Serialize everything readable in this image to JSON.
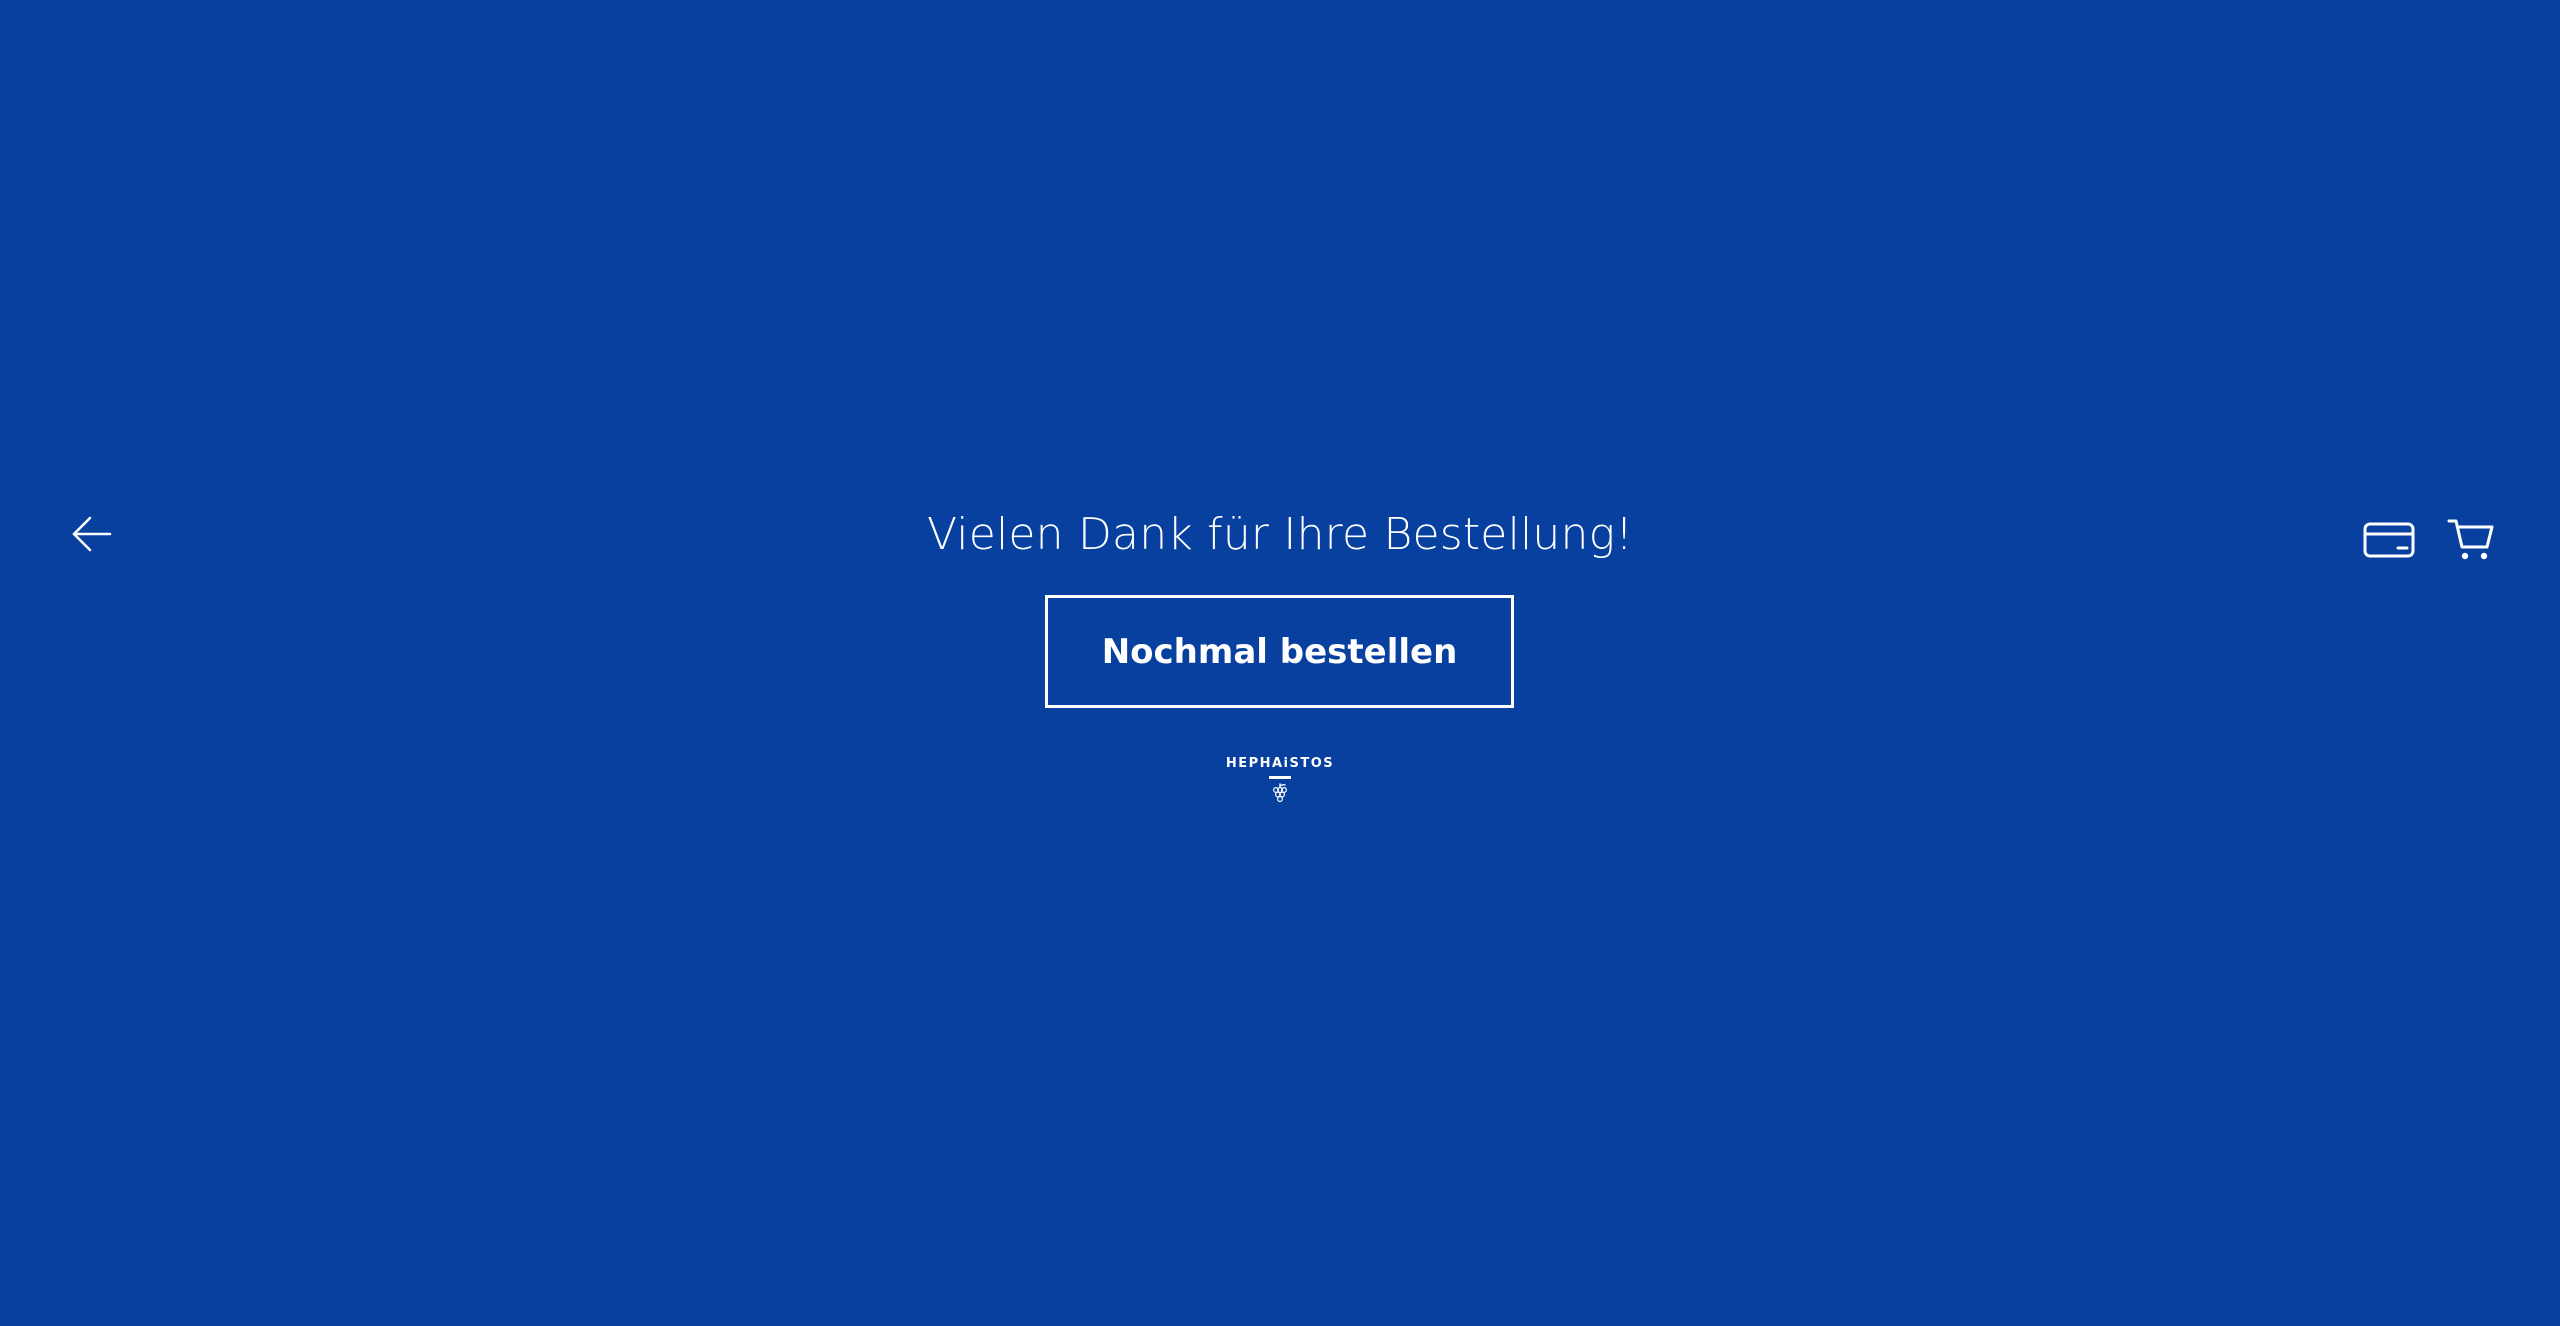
{
  "page": {
    "background_color": "#08409F",
    "foreground_color": "#FFFFFF"
  },
  "header": {
    "back_icon": "arrow-left-icon",
    "card_icon": "credit-card-icon",
    "cart_icon": "shopping-cart-icon"
  },
  "main": {
    "title": "Vielen Dank für Ihre Bestellung!",
    "order_again_label": "Nochmal bestellen"
  },
  "logo": {
    "text": "HEPHAiSTOS",
    "emblem_icon": "grape-cluster-icon"
  }
}
